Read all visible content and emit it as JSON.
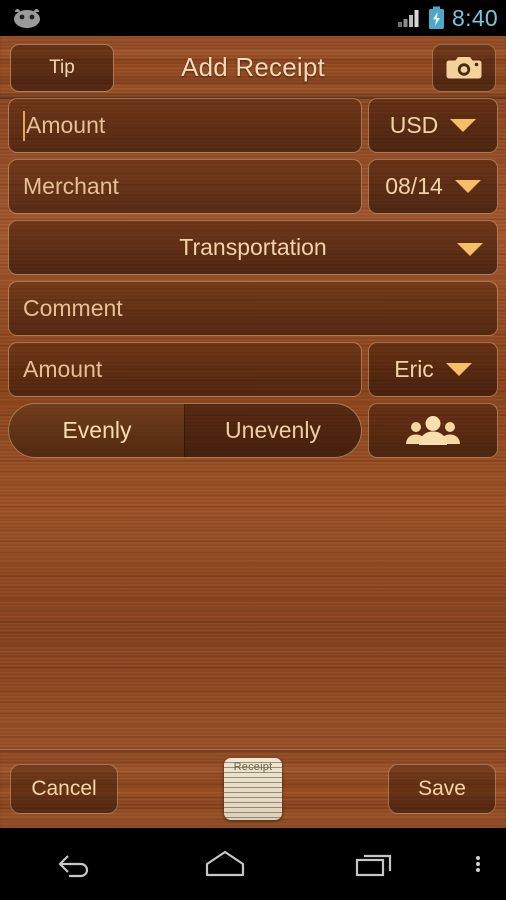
{
  "status_bar": {
    "left_icon": "cyanogenmod-head-icon",
    "signal_icon": "signal-bars-icon",
    "battery_icon": "battery-charging-icon",
    "clock": "8:40",
    "clock_color": "#77c4de"
  },
  "action_bar": {
    "tip_label": "Tip",
    "title": "Add Receipt",
    "camera_icon": "camera-icon"
  },
  "form": {
    "amount_placeholder": "Amount",
    "currency_value": "USD",
    "merchant_placeholder": "Merchant",
    "date_value": "08/14",
    "category_value": "Transportation",
    "comment_placeholder": "Comment",
    "share_amount_placeholder": "Amount",
    "payer_value": "Eric",
    "split_evenly_label": "Evenly",
    "split_unevenly_label": "Unevenly",
    "split_selected": "Evenly",
    "people_icon": "people-group-icon"
  },
  "bottom_bar": {
    "cancel_label": "Cancel",
    "save_label": "Save",
    "receipt_thumb_label": "Receipt",
    "receipt_thumb_icon": "receipt-thumbnail-icon"
  },
  "nav_bar": {
    "back_icon": "back-arrow-icon",
    "home_icon": "home-icon",
    "recents_icon": "recent-apps-icon",
    "overflow_icon": "overflow-menu-icon"
  },
  "theme": {
    "wood_base": "#8e421c",
    "text_cream": "#f3d6b2",
    "accent_amber": "#f5bf67",
    "caret_color": "#e8a54c"
  }
}
